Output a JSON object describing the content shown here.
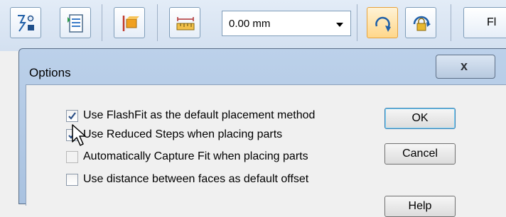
{
  "toolbar": {
    "buttons": [
      {
        "icon": "flashfit-icon"
      },
      {
        "icon": "document-list-icon"
      },
      {
        "icon": "face-part-icon"
      },
      {
        "icon": "ruler-icon"
      },
      {
        "icon": "rotate-arrow-icon"
      },
      {
        "icon": "lock-rotate-icon"
      }
    ],
    "offset_value": "0.00 mm",
    "truncated_button_label": "Fl"
  },
  "dialog": {
    "title": "Options",
    "close_label": "x",
    "options": [
      {
        "label": "Use FlashFit as the default placement method",
        "checked": true,
        "enabled": true
      },
      {
        "label": "Use Reduced Steps when placing parts",
        "checked": true,
        "enabled": true
      },
      {
        "label": "Automatically Capture Fit when placing parts",
        "checked": false,
        "enabled": false
      },
      {
        "label": "Use distance between faces as default offset",
        "checked": false,
        "enabled": true
      }
    ],
    "ok_label": "OK",
    "cancel_label": "Cancel",
    "help_label": "Help"
  },
  "colors": {
    "accent": "#e6a23c",
    "check": "#2b4f86",
    "dialog_frame": "#a9c2e0"
  }
}
